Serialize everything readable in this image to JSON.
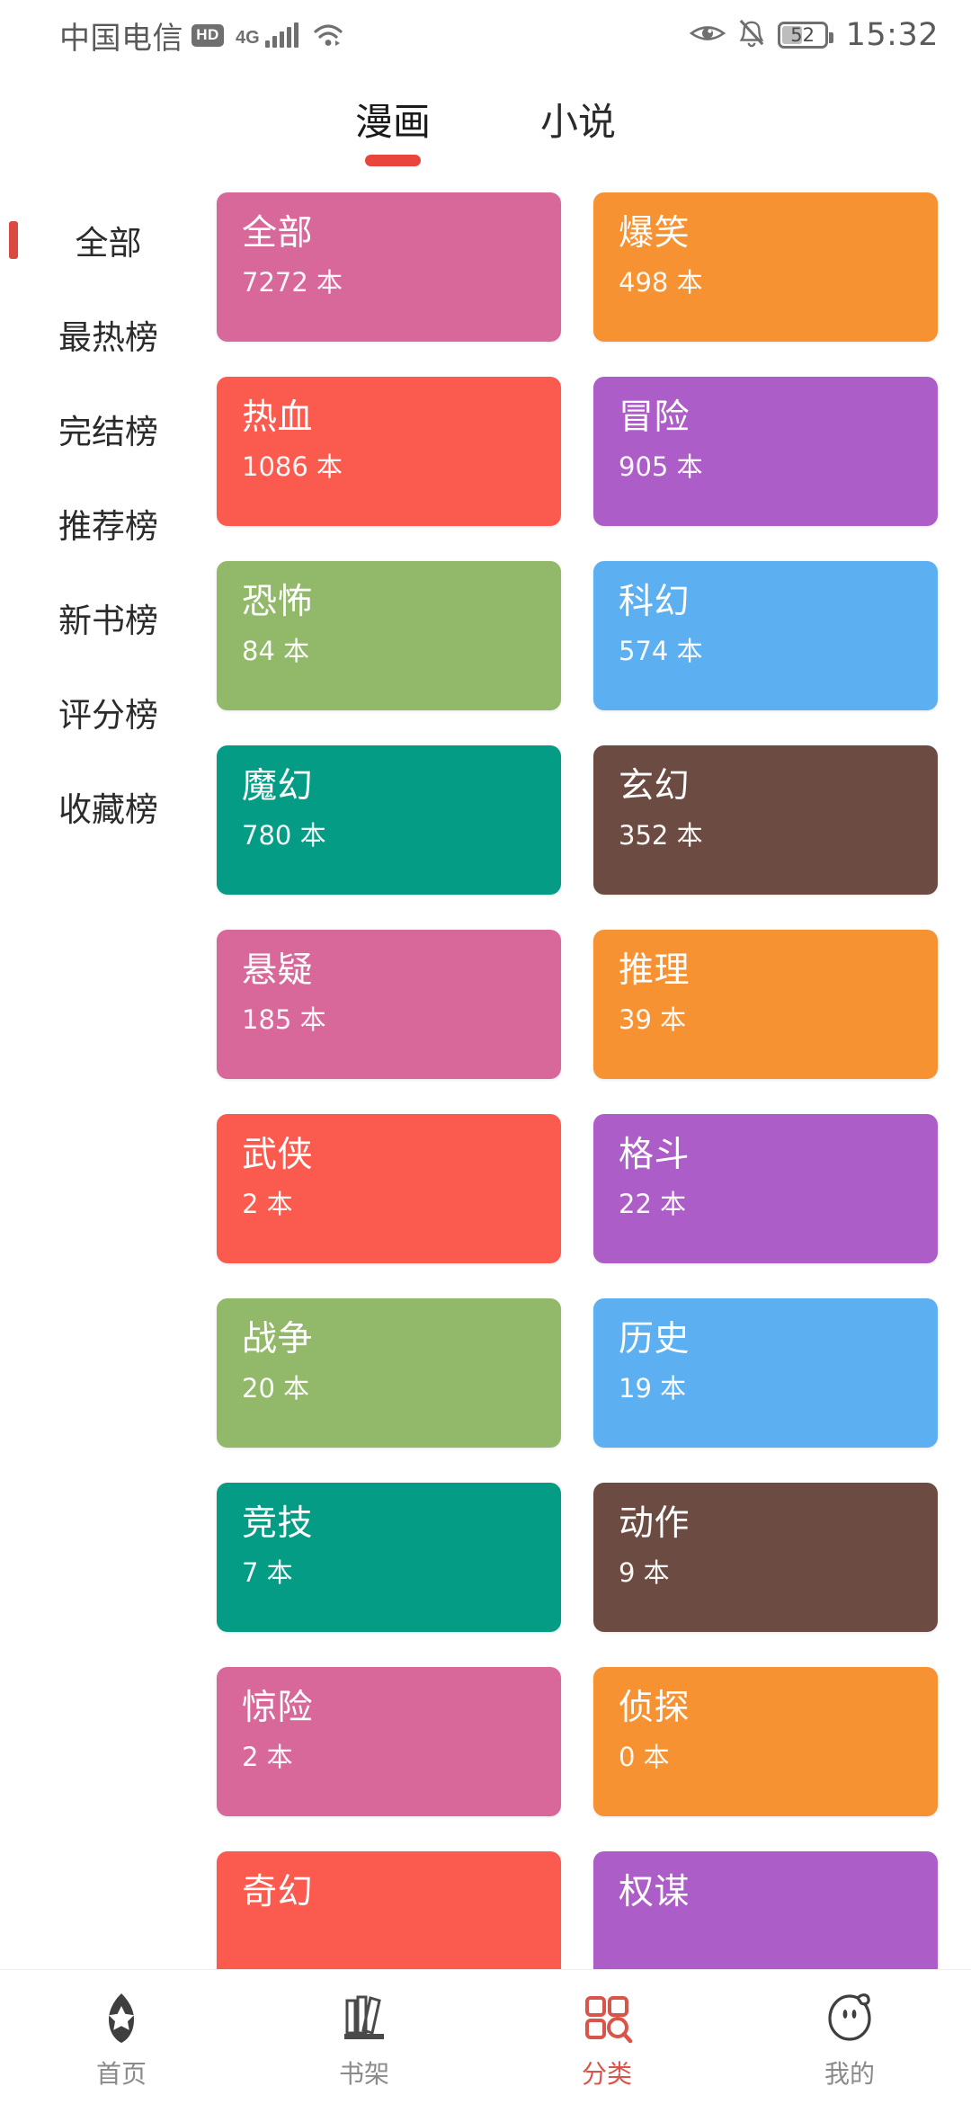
{
  "status_bar": {
    "carrier": "中国电信",
    "hd_badge": "HD",
    "network": "4G",
    "signal_icon": "signal-bars-icon",
    "wifi_icon": "wifi-icon",
    "eye_icon": "eye-care-icon",
    "mute_icon": "bell-muted-icon",
    "battery_icon": "battery-icon",
    "battery_percent": "52",
    "battery_level_pct": 52,
    "time": "15:32"
  },
  "tabs": [
    {
      "label": "漫画",
      "active": true
    },
    {
      "label": "小说",
      "active": false
    }
  ],
  "tab_accent_color": "#e8453c",
  "sidebar": {
    "items": [
      {
        "label": "全部",
        "selected": true
      },
      {
        "label": "最热榜",
        "selected": false
      },
      {
        "label": "完结榜",
        "selected": false
      },
      {
        "label": "推荐榜",
        "selected": false
      },
      {
        "label": "新书榜",
        "selected": false
      },
      {
        "label": "评分榜",
        "selected": false
      },
      {
        "label": "收藏榜",
        "selected": false
      }
    ],
    "marker_color": "#d94b40"
  },
  "categories": [
    {
      "title": "全部",
      "count": "7272 本",
      "color": "#d9689a"
    },
    {
      "title": "爆笑",
      "count": "498 本",
      "color": "#f79232"
    },
    {
      "title": "热血",
      "count": "1086 本",
      "color": "#fb5a4e"
    },
    {
      "title": "冒险",
      "count": "905 本",
      "color": "#ad5dc8"
    },
    {
      "title": "恐怖",
      "count": "84 本",
      "color": "#92b86a"
    },
    {
      "title": "科幻",
      "count": "574 本",
      "color": "#5cb0f2"
    },
    {
      "title": "魔幻",
      "count": "780 本",
      "color": "#059c85"
    },
    {
      "title": "玄幻",
      "count": "352 本",
      "color": "#6c4c42"
    },
    {
      "title": "悬疑",
      "count": "185 本",
      "color": "#d9689a"
    },
    {
      "title": "推理",
      "count": "39 本",
      "color": "#f79232"
    },
    {
      "title": "武侠",
      "count": "2 本",
      "color": "#fb5a4e"
    },
    {
      "title": "格斗",
      "count": "22 本",
      "color": "#ad5dc8"
    },
    {
      "title": "战争",
      "count": "20 本",
      "color": "#92b86a"
    },
    {
      "title": "历史",
      "count": "19 本",
      "color": "#5cb0f2"
    },
    {
      "title": "竞技",
      "count": "7 本",
      "color": "#059c85"
    },
    {
      "title": "动作",
      "count": "9 本",
      "color": "#6c4c42"
    },
    {
      "title": "惊险",
      "count": "2 本",
      "color": "#d9689a"
    },
    {
      "title": "侦探",
      "count": "0 本",
      "color": "#f79232"
    },
    {
      "title": "奇幻",
      "count": "",
      "color": "#fb5a4e"
    },
    {
      "title": "权谋",
      "count": "",
      "color": "#ad5dc8"
    }
  ],
  "bottom_nav": {
    "active_color": "#d9544a",
    "inactive_color": "#8a8a8a",
    "items": [
      {
        "label": "首页",
        "icon": "home-star-icon",
        "active": false
      },
      {
        "label": "书架",
        "icon": "bookshelf-icon",
        "active": false
      },
      {
        "label": "分类",
        "icon": "category-grid-search-icon",
        "active": true
      },
      {
        "label": "我的",
        "icon": "profile-face-icon",
        "active": false
      }
    ]
  }
}
